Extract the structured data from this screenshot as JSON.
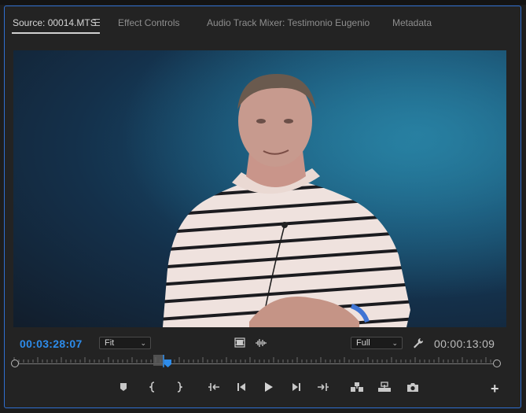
{
  "tabs": [
    {
      "label": "Source: 00014.MTS",
      "active": true
    },
    {
      "label": "Effect Controls",
      "active": false
    },
    {
      "label": "Audio Track Mixer: Testimonio Eugenio",
      "active": false
    },
    {
      "label": "Metadata",
      "active": false
    }
  ],
  "source": {
    "timecode_current": "00:03:28:07",
    "timecode_duration": "00:00:13:09",
    "zoom": {
      "selected": "Fit"
    },
    "resolution": {
      "selected": "Full"
    }
  },
  "colors": {
    "accent": "#2d8ceb",
    "panel_border": "#2f6fd0",
    "panel_bg": "#232323"
  },
  "icons": {
    "panel_menu": "hamburger-menu-icon",
    "drag_video": "film-strip-icon",
    "drag_audio": "waveform-icon",
    "settings": "wrench-icon",
    "transport": [
      "add-marker-icon",
      "mark-in-icon",
      "mark-out-icon",
      "go-to-in-icon",
      "step-back-icon",
      "play-icon",
      "step-forward-icon",
      "go-to-out-icon",
      "insert-icon",
      "overwrite-icon",
      "export-frame-icon"
    ],
    "button_editor": "plus-icon"
  }
}
